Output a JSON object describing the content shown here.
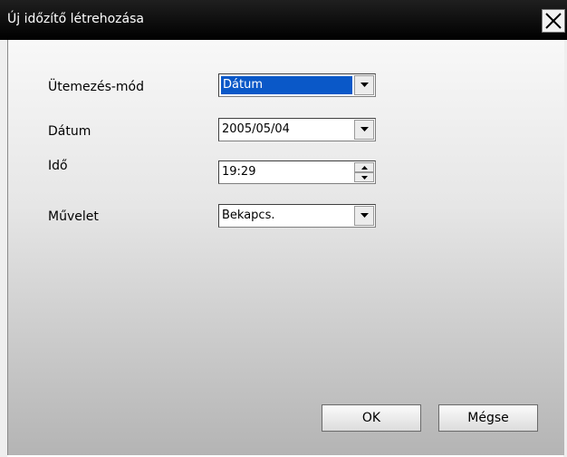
{
  "window": {
    "title": "Új időzítő létrehozása",
    "close_icon": "close-icon"
  },
  "form": {
    "schedule_mode": {
      "label": "Ütemezés-mód",
      "value": "Dátum"
    },
    "date": {
      "label": "Dátum",
      "value": "2005/05/04"
    },
    "time": {
      "label": "Idő",
      "value": "19:29"
    },
    "operation": {
      "label": "Művelet",
      "value": "Bekapcs."
    }
  },
  "buttons": {
    "ok": "OK",
    "cancel": "Mégse"
  },
  "icons": {
    "dropdown": "chevron-down-icon",
    "spin_up": "spin-up-icon",
    "spin_down": "spin-down-icon"
  },
  "colors": {
    "titlebar": "#000000",
    "selection": "#0a58c8"
  }
}
